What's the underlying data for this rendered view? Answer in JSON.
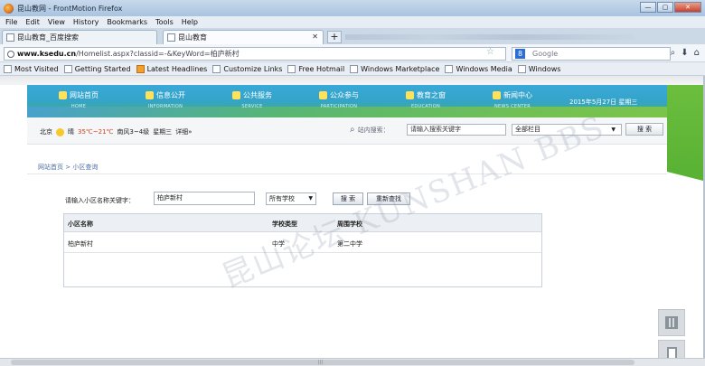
{
  "window": {
    "title": "昆山教网 - FrontMotion Firefox",
    "controls": [
      "—",
      "▢",
      "✕"
    ]
  },
  "menu": [
    "File",
    "Edit",
    "View",
    "History",
    "Bookmarks",
    "Tools",
    "Help"
  ],
  "tabs": [
    {
      "label": "昆山教育_百度搜索",
      "close": "✕"
    },
    {
      "label": "昆山教育",
      "close": "✕"
    }
  ],
  "newtab_label": "+",
  "address": {
    "host": "www.ksedu.cn",
    "path": "/Homelist.aspx?classid=-&KeyWord=柏庐新村"
  },
  "search_box": {
    "placeholder": "Google",
    "engine_icon": "8"
  },
  "bookmarks": [
    "Most Visited",
    "Getting Started",
    "Latest Headlines",
    "Customize Links",
    "Free Hotmail",
    "Windows Marketplace",
    "Windows Media",
    "Windows"
  ],
  "site_nav": [
    {
      "zh": "网站首页",
      "en": "HOME",
      "icon": "home-icon"
    },
    {
      "zh": "信息公开",
      "en": "INFORMATION",
      "icon": "info-icon"
    },
    {
      "zh": "公共服务",
      "en": "SERVICE",
      "icon": "service-icon"
    },
    {
      "zh": "公众参与",
      "en": "PARTICIPATION",
      "icon": "participation-icon"
    },
    {
      "zh": "教育之窗",
      "en": "EDUCATION",
      "icon": "education-icon"
    },
    {
      "zh": "新闻中心",
      "en": "NEWS CENTER",
      "icon": "news-icon"
    }
  ],
  "header_date": "2015年5月27日 星期三",
  "weather": {
    "city": "北京",
    "cond": "晴",
    "temp": "35℃~21℃",
    "wind": "南风3~4级",
    "weekday": "星期三",
    "detail": "详细»"
  },
  "site_search": {
    "label": "站内搜索：",
    "value": "请输入搜索关键字",
    "select": "全部栏目",
    "button": "搜 索"
  },
  "breadcrumb": "网站首页 > 小区查询",
  "query": {
    "label": "请输入小区名称关键字：",
    "value": "柏庐新村",
    "school_select": "所有学校",
    "search_button": "搜 索",
    "reset_button": "重新查找"
  },
  "table": {
    "headers": [
      "小区名称",
      "学校类型",
      "周围学校"
    ],
    "rows": [
      [
        "柏庐新村",
        "中学",
        "第二中学"
      ]
    ]
  },
  "watermark": "昆山论坛 KUNSHAN BBS"
}
